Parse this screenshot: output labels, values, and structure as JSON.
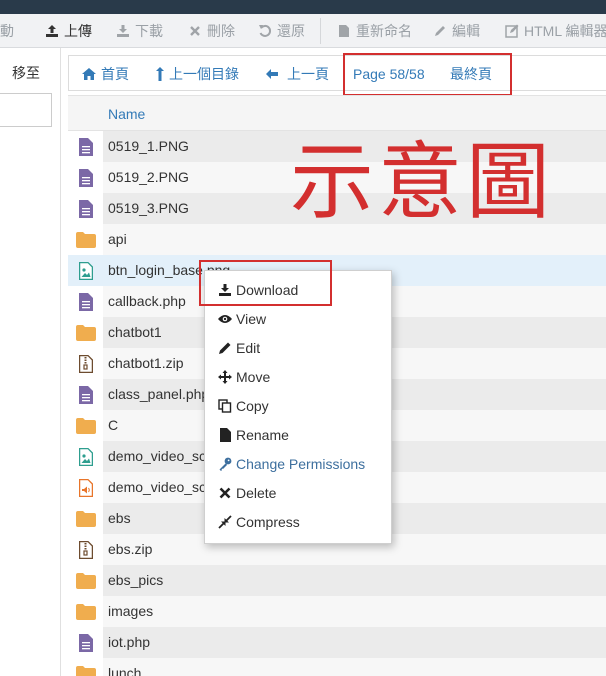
{
  "toolbar": {
    "items": [
      {
        "label": "移動",
        "icon": "move-icon"
      },
      {
        "label": "上傳",
        "icon": "upload-icon"
      },
      {
        "label": "下載",
        "icon": "download-icon"
      },
      {
        "label": "刪除",
        "icon": "delete-icon"
      },
      {
        "label": "還原",
        "icon": "restore-icon"
      },
      {
        "label": "重新命名",
        "icon": "rename-icon"
      },
      {
        "label": "編輯",
        "icon": "edit-icon"
      },
      {
        "label": "HTML 編輯器",
        "icon": "html-editor-icon"
      }
    ]
  },
  "left_panel": {
    "goto_label": "移至"
  },
  "nav": {
    "home": "首頁",
    "up_dir": "上一個目錄",
    "prev_page": "上一頁",
    "page_info": "Page 58/58",
    "last_page": "最終頁"
  },
  "table": {
    "header": "Name",
    "rows": [
      {
        "name": "0519_1.PNG",
        "type": "doc"
      },
      {
        "name": "0519_2.PNG",
        "type": "doc"
      },
      {
        "name": "0519_3.PNG",
        "type": "doc"
      },
      {
        "name": "api",
        "type": "folder"
      },
      {
        "name": "btn_login_base.png",
        "type": "image"
      },
      {
        "name": "callback.php",
        "type": "doc"
      },
      {
        "name": "chatbot1",
        "type": "folder"
      },
      {
        "name": "chatbot1.zip",
        "type": "zip"
      },
      {
        "name": "class_panel.php",
        "type": "doc"
      },
      {
        "name": "C",
        "type": "folder"
      },
      {
        "name": "demo_video_sc",
        "type": "image"
      },
      {
        "name": "demo_video_sc",
        "type": "audio"
      },
      {
        "name": "ebs",
        "type": "folder"
      },
      {
        "name": "ebs.zip",
        "type": "zip"
      },
      {
        "name": "ebs_pics",
        "type": "folder"
      },
      {
        "name": "images",
        "type": "folder"
      },
      {
        "name": "iot.php",
        "type": "doc"
      },
      {
        "name": "lunch",
        "type": "folder"
      }
    ]
  },
  "watermark": "示意圖",
  "context_menu": {
    "items": [
      {
        "label": "Download",
        "icon": "download-icon"
      },
      {
        "label": "View",
        "icon": "eye-icon"
      },
      {
        "label": "Edit",
        "icon": "pencil-icon"
      },
      {
        "label": "Move",
        "icon": "move-arrows-icon"
      },
      {
        "label": "Copy",
        "icon": "copy-icon"
      },
      {
        "label": "Rename",
        "icon": "file-icon"
      },
      {
        "label": "Change Permissions",
        "icon": "key-icon"
      },
      {
        "label": "Delete",
        "icon": "x-icon"
      },
      {
        "label": "Compress",
        "icon": "compress-icon"
      }
    ]
  },
  "colors": {
    "accent": "#337ab7",
    "annotation": "#d32f2f",
    "folder": "#f0ad4e",
    "doc": "#7b68a6",
    "image": "#2e9e8f",
    "audio": "#e8752a"
  }
}
